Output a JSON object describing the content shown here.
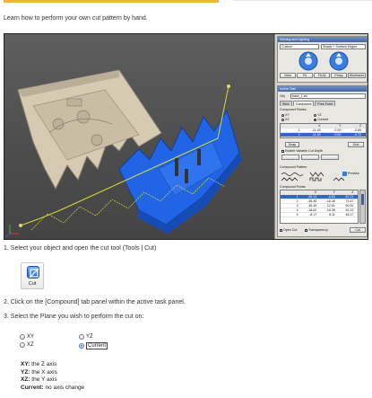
{
  "intro": "Learn how to perform your own cut pattern by hand.",
  "app": {
    "viewing_title": "Viewing and Lighting",
    "view_mode": "Custom",
    "shade_mode": "Shade + Surface Edges",
    "view_buttons": [
      "View",
      "Fit",
      "Fit All",
      "Persp",
      "Wireframe"
    ],
    "task_title": "Active Task",
    "object_label": "Obj",
    "object_value": "base_1.stl",
    "tabs": [
      "Slice",
      "Compound",
      "Free Form"
    ],
    "active_tab": "Compound",
    "planes_label": "Compound Planes",
    "planes": [
      {
        "label": "XY",
        "selected": false
      },
      {
        "label": "YZ",
        "selected": false
      },
      {
        "label": "XZ",
        "selected": false
      },
      {
        "label": "Current",
        "selected": true
      }
    ],
    "grid_header": [
      "X",
      "Y",
      "Z"
    ],
    "grid_top_rows": [
      [
        "-11.45",
        "0.00",
        "-0.85"
      ],
      [
        "11.45",
        "0.00",
        "-0.72"
      ]
    ],
    "snap_label": "Snap",
    "grid_btn": "Grid",
    "variable_depth_label": "Enable Variable Cut Depth",
    "pattern_label": "Compound Pattern",
    "preview_label": "Preview",
    "points_label": "Compound Points",
    "points_header": [
      "X",
      "Y",
      "Z"
    ],
    "points_rows": [
      [
        "-46.13",
        "-6.63",
        "87.21"
      ],
      [
        "-36.45",
        "-18.36",
        "74.47"
      ],
      [
        "-36.45",
        "12.61",
        "60.61"
      ],
      [
        "-18.62",
        "-18.36",
        "61.22"
      ],
      [
        "-8.17",
        "8.11",
        "48.17"
      ]
    ],
    "open_cut_label": "Open Cut",
    "transparency_label": "Transparency",
    "cut_label": "Cut"
  },
  "steps": [
    "1. Select your object and open the cut tool (Tools | Cut)",
    "2. Click on the [Compound] tab panel within the active task panel.",
    "3. Select the Plane you wish to perform the cut on:"
  ],
  "cut_button_label": "Cut",
  "plane_options": [
    {
      "label": "XY",
      "selected": false
    },
    {
      "label": "YZ",
      "selected": false
    },
    {
      "label": "XZ",
      "selected": false
    },
    {
      "label": "Current",
      "selected": true
    }
  ],
  "axis_notes": [
    {
      "key": "XY:",
      "value": " the Z axis"
    },
    {
      "key": "YZ:",
      "value": " the X axis"
    },
    {
      "key": "XZ:",
      "value": " the Y axis"
    },
    {
      "key": "Current:",
      "value": " no axis change"
    }
  ],
  "colors": {
    "accent": "#f0b43a",
    "part_beige": "#d8cdb8",
    "part_blue": "#1f63e0",
    "cut_curve": "#d8d840"
  }
}
